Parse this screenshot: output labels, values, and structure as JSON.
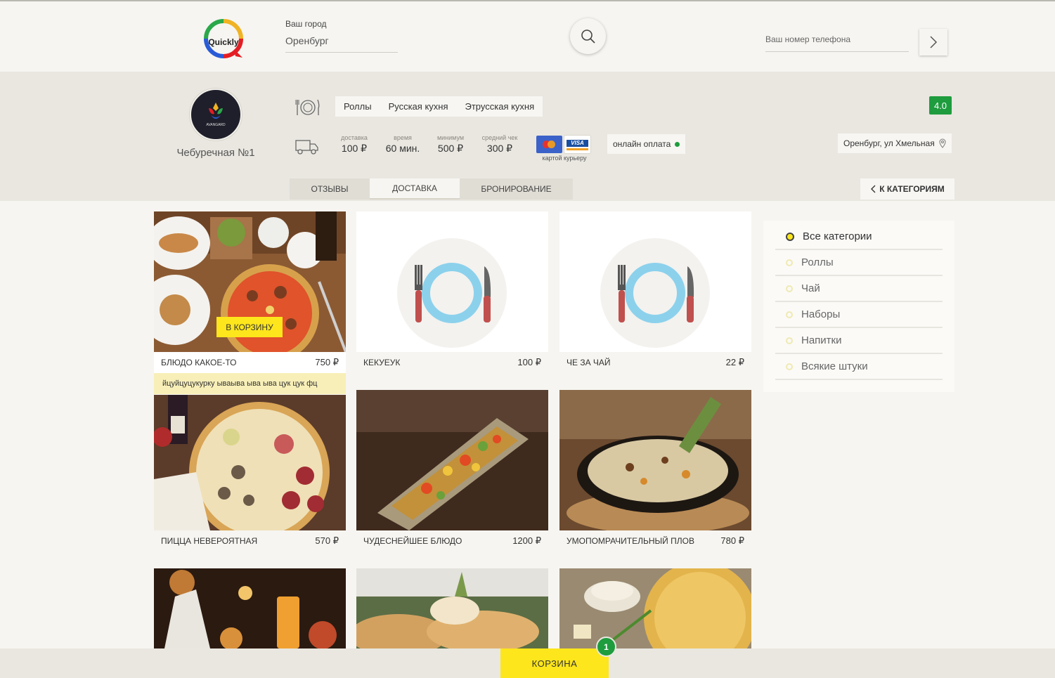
{
  "header": {
    "logo_text": "Quickly",
    "city_label": "Ваш город",
    "city_value": "Оренбург",
    "phone_placeholder": "Ваш номер телефона"
  },
  "restaurant": {
    "logo_text": "AVANGARD",
    "name": "Чебуречная №1",
    "cuisines": [
      "Роллы",
      "Русская кухня",
      "Этрусская кухня"
    ],
    "stats": [
      {
        "label": "доставка",
        "value": "100 ₽"
      },
      {
        "label": "время",
        "value": "60 мин."
      },
      {
        "label": "минимум",
        "value": "500 ₽"
      },
      {
        "label": "средний чек",
        "value": "300 ₽"
      }
    ],
    "card_brand": "VISA",
    "cards_caption": "картой курьеру",
    "online_payment": "онлайн оплата",
    "rating": "4.0",
    "address": "Оренбург, ул Хмельная"
  },
  "tabs": [
    {
      "label": "ОТЗЫВЫ",
      "active": false
    },
    {
      "label": "ДОСТАВКА",
      "active": true
    },
    {
      "label": "БРОНИРОВАНИЕ",
      "active": false
    }
  ],
  "back_button": "К КАТЕГОРИЯМ",
  "products": [
    {
      "name": "БЛЮДО КАКОЕ-ТО",
      "price": "750 ₽",
      "image": "pizza-table-photo",
      "add_to_cart": "В КОРЗИНУ",
      "description": "йцуйцуцукурку ываыва ыва ыва цук цук фц"
    },
    {
      "name": "КЕКУЕУК",
      "price": "100 ₽",
      "image": "plate-placeholder"
    },
    {
      "name": "ЧЕ ЗА ЧАЙ",
      "price": "22 ₽",
      "image": "plate-placeholder"
    },
    {
      "name": "ПИЦЦА НЕВЕРОЯТНАЯ",
      "price": "570 ₽",
      "image": "pizza-photo"
    },
    {
      "name": "ЧУДЕСНЕЙШЕЕ БЛЮДО",
      "price": "1200 ₽",
      "image": "vegetable-platter-photo"
    },
    {
      "name": "УМОПОМРАЧИТЕЛЬНЫЙ ПЛОВ",
      "price": "780 ₽",
      "image": "pilaf-pan-photo"
    },
    {
      "name": "",
      "price": "",
      "image": "restaurant-table-photo"
    },
    {
      "name": "",
      "price": "",
      "image": "bread-photo"
    },
    {
      "name": "",
      "price": "",
      "image": "khachapuri-photo"
    }
  ],
  "categories": [
    {
      "label": "Все категории",
      "active": true
    },
    {
      "label": "Роллы",
      "active": false
    },
    {
      "label": "Чай",
      "active": false
    },
    {
      "label": "Наборы",
      "active": false
    },
    {
      "label": "Напитки",
      "active": false
    },
    {
      "label": "Всякие штуки",
      "active": false
    }
  ],
  "cart": {
    "label": "КОРЗИНА",
    "count": "1"
  },
  "colors": {
    "accent_yellow": "#fde61b",
    "status_green": "#1e9c3e",
    "band_bg": "#e9e7e0",
    "page_bg": "#f6f5f1"
  }
}
